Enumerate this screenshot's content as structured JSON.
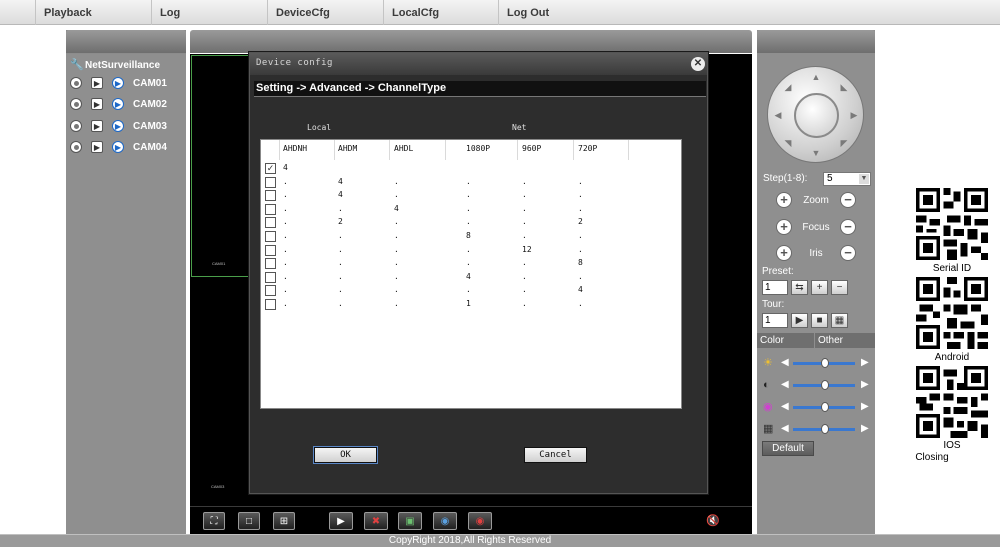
{
  "menu": [
    "Playback",
    "Log",
    "DeviceCfg",
    "LocalCfg",
    "Log Out"
  ],
  "tree": {
    "root": "NetSurveillance",
    "cams": [
      "CAM01",
      "CAM02",
      "CAM03",
      "CAM04"
    ]
  },
  "video": {
    "cell_labels": [
      "CAM01",
      "CAM03"
    ]
  },
  "dialog": {
    "title": "Device config",
    "path": "Setting -> Advanced -> ChannelType",
    "group_local": "Local",
    "group_net": "Net",
    "columns": [
      "AHDNH",
      "AHDM",
      "AHDL",
      "1080P",
      "960P",
      "720P"
    ],
    "rows": [
      {
        "checked": true,
        "cells": [
          "4",
          "",
          "",
          "",
          "",
          ""
        ]
      },
      {
        "checked": false,
        "cells": [
          ".",
          "4",
          ".",
          ".",
          ".",
          "."
        ]
      },
      {
        "checked": false,
        "cells": [
          ".",
          "4",
          ".",
          ".",
          ".",
          "."
        ]
      },
      {
        "checked": false,
        "cells": [
          ".",
          ".",
          "4",
          ".",
          ".",
          "."
        ]
      },
      {
        "checked": false,
        "cells": [
          ".",
          "2",
          ".",
          ".",
          ".",
          "2"
        ]
      },
      {
        "checked": false,
        "cells": [
          ".",
          ".",
          ".",
          "8",
          ".",
          "."
        ]
      },
      {
        "checked": false,
        "cells": [
          ".",
          ".",
          ".",
          ".",
          "12",
          "."
        ]
      },
      {
        "checked": false,
        "cells": [
          ".",
          ".",
          ".",
          ".",
          ".",
          "8"
        ]
      },
      {
        "checked": false,
        "cells": [
          ".",
          ".",
          ".",
          "4",
          ".",
          "."
        ]
      },
      {
        "checked": false,
        "cells": [
          ".",
          ".",
          ".",
          ".",
          ".",
          "4"
        ]
      },
      {
        "checked": false,
        "cells": [
          ".",
          ".",
          ".",
          "1",
          ".",
          "."
        ]
      }
    ],
    "ok_label": "OK",
    "cancel_label": "Cancel"
  },
  "ptz": {
    "step_label": "Step(1-8):",
    "step_value": "5",
    "zoom_label": "Zoom",
    "focus_label": "Focus",
    "iris_label": "Iris",
    "preset_label": "Preset:",
    "preset_value": "1",
    "tour_label": "Tour:",
    "tour_value": "1",
    "tab_color": "Color",
    "tab_other": "Other",
    "default_label": "Default"
  },
  "qr": {
    "serial_label": "Serial ID",
    "android_label": "Android",
    "ios_label": "IOS",
    "closing_label": "Closing"
  },
  "footer": "CopyRight 2018,All Rights Reserved"
}
